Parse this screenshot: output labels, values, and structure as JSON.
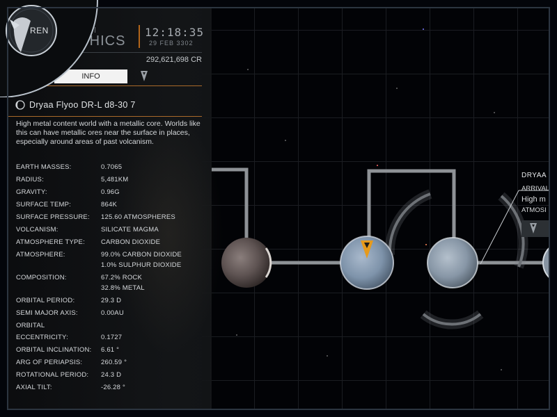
{
  "header": {
    "brand_top": "rsal",
    "brand_bottom": "APHICS",
    "time": "12:18:35",
    "date": "29 FEB 3302",
    "credits": "292,621,698 CR"
  },
  "badge": {
    "label": "REN"
  },
  "tabs": {
    "info_label": "INFO",
    "nav_icon": "map-marker-icon"
  },
  "body": {
    "name": "Dryaa Flyoo DR-L d8-30 7",
    "description": "High metal content world with a metallic core. Worlds like this can have metallic ores near the surface in places, especially around areas of past volcanism."
  },
  "properties": [
    {
      "label": "EARTH MASSES:",
      "value": [
        "0.7065"
      ]
    },
    {
      "label": "RADIUS:",
      "value": [
        "5,481KM"
      ]
    },
    {
      "label": "GRAVITY:",
      "value": [
        "0.96G"
      ]
    },
    {
      "label": "SURFACE TEMP:",
      "value": [
        "864K"
      ]
    },
    {
      "label": "SURFACE PRESSURE:",
      "value": [
        "125.60 ATMOSPHERES"
      ]
    },
    {
      "label": "VOLCANISM:",
      "value": [
        "SILICATE MAGMA"
      ]
    },
    {
      "label": "ATMOSPHERE TYPE:",
      "value": [
        "CARBON DIOXIDE"
      ]
    },
    {
      "label": "ATMOSPHERE:",
      "value": [
        "99.0% CARBON DIOXIDE",
        "1.0% SULPHUR DIOXIDE"
      ]
    },
    {
      "label": "COMPOSITION:",
      "value": [
        "67.2% ROCK",
        "32.8% METAL"
      ]
    },
    {
      "label": "ORBITAL PERIOD:",
      "value": [
        "29.3 D"
      ]
    },
    {
      "label": "SEMI MAJOR AXIS:",
      "value": [
        "0.00AU"
      ]
    },
    {
      "label": "ORBITAL",
      "value": [
        ""
      ]
    },
    {
      "label": "ECCENTRICITY:",
      "value": [
        "0.1727"
      ]
    },
    {
      "label": "ORBITAL INCLINATION:",
      "value": [
        "6.61 °"
      ]
    },
    {
      "label": "ARG OF PERIAPSIS:",
      "value": [
        "260.59 °"
      ]
    },
    {
      "label": "ROTATIONAL PERIOD:",
      "value": [
        "24.3 D"
      ]
    },
    {
      "label": "AXIAL TILT:",
      "value": [
        "-26.28 °"
      ]
    }
  ],
  "map_tag": {
    "title": "DRYAA",
    "line1": "ARRIVAL",
    "line2": "High m",
    "line3": "ATMOSI"
  },
  "colors": {
    "accent_orange": "#e69a1c",
    "rule_orange": "#aa6a2a",
    "connector_grey": "#8e9296",
    "grid": "#1b1d22"
  }
}
